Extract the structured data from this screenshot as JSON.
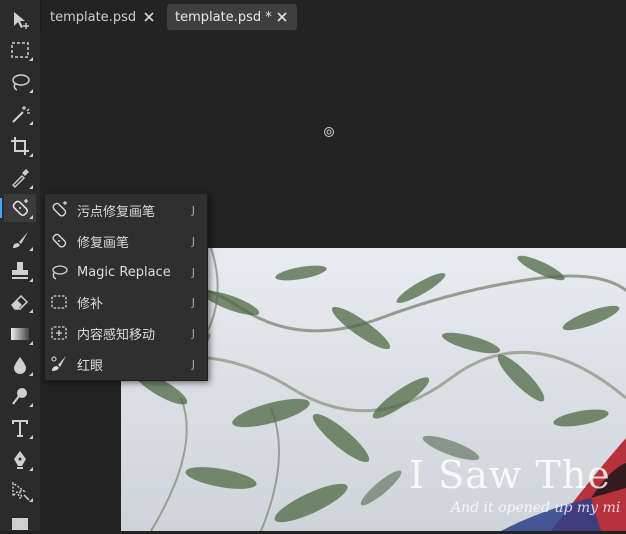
{
  "tabs": [
    {
      "label": "template.psd",
      "active": false
    },
    {
      "label": "template.psd *",
      "active": true
    }
  ],
  "toolbar": {
    "tools": [
      {
        "name": "move-tool",
        "icon": "move-arrow-icon"
      },
      {
        "name": "marquee-tool",
        "icon": "marquee-icon"
      },
      {
        "name": "lasso-tool",
        "icon": "lasso-icon"
      },
      {
        "name": "magic-wand-tool",
        "icon": "magic-wand-icon"
      },
      {
        "name": "crop-tool",
        "icon": "crop-icon"
      },
      {
        "name": "eyedropper-tool",
        "icon": "eyedropper-icon"
      },
      {
        "name": "healing-brush-tool",
        "icon": "bandage-icon",
        "active": true
      },
      {
        "name": "brush-tool",
        "icon": "brush-icon"
      },
      {
        "name": "stamp-tool",
        "icon": "stamp-icon"
      },
      {
        "name": "eraser-tool",
        "icon": "eraser-icon"
      },
      {
        "name": "gradient-tool",
        "icon": "gradient-icon"
      },
      {
        "name": "blur-tool",
        "icon": "drop-icon"
      },
      {
        "name": "dodge-tool",
        "icon": "dodge-icon"
      },
      {
        "name": "type-tool",
        "icon": "type-icon"
      },
      {
        "name": "pen-tool",
        "icon": "pen-icon"
      },
      {
        "name": "path-select-tool",
        "icon": "path-select-icon"
      },
      {
        "name": "shape-tool",
        "icon": "rectangle-icon"
      }
    ]
  },
  "flyout": {
    "items": [
      {
        "label": "污点修复画笔",
        "shortcut": "J",
        "icon": "spot-healing-icon"
      },
      {
        "label": "修复画笔",
        "shortcut": "J",
        "icon": "healing-brush-icon"
      },
      {
        "label": "Magic Replace",
        "shortcut": "J",
        "icon": "magic-replace-icon"
      },
      {
        "label": "修补",
        "shortcut": "J",
        "icon": "patch-icon"
      },
      {
        "label": "内容感知移动",
        "shortcut": "J",
        "icon": "content-aware-move-icon"
      },
      {
        "label": "红眼",
        "shortcut": "J",
        "icon": "red-eye-icon"
      }
    ]
  },
  "canvas": {
    "headline": "I Saw The S",
    "subline": "And it opened up my mi"
  },
  "colors": {
    "accent": "#4aa3ff",
    "panel": "#2b2b2b",
    "background": "#232323"
  }
}
